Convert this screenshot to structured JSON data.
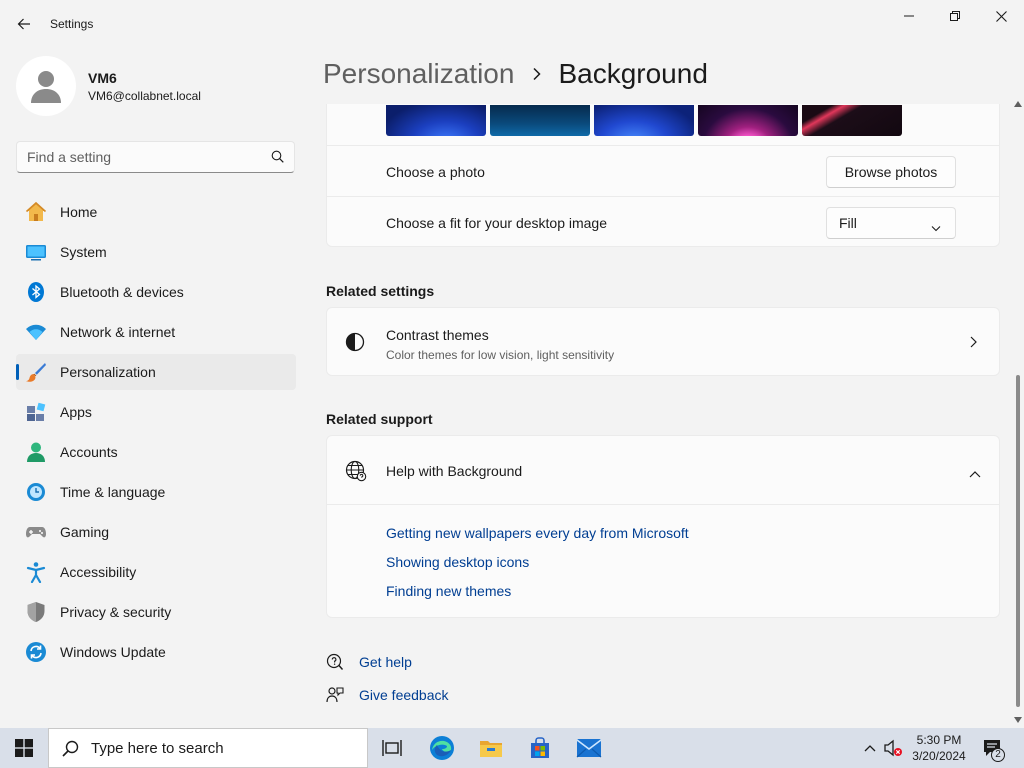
{
  "window": {
    "title": "Settings",
    "controls": [
      "minimize",
      "maximize",
      "close"
    ]
  },
  "user": {
    "name": "VM6",
    "email": "VM6@collabnet.local"
  },
  "search": {
    "placeholder": "Find a setting"
  },
  "sidebar": {
    "items": [
      {
        "label": "Home",
        "icon": "home-icon"
      },
      {
        "label": "System",
        "icon": "system-icon"
      },
      {
        "label": "Bluetooth & devices",
        "icon": "bluetooth-icon"
      },
      {
        "label": "Network & internet",
        "icon": "wifi-icon"
      },
      {
        "label": "Personalization",
        "icon": "brush-icon",
        "active": true
      },
      {
        "label": "Apps",
        "icon": "apps-icon"
      },
      {
        "label": "Accounts",
        "icon": "accounts-icon"
      },
      {
        "label": "Time & language",
        "icon": "clock-globe-icon"
      },
      {
        "label": "Gaming",
        "icon": "gamepad-icon"
      },
      {
        "label": "Accessibility",
        "icon": "accessibility-icon"
      },
      {
        "label": "Privacy & security",
        "icon": "shield-icon"
      },
      {
        "label": "Windows Update",
        "icon": "update-icon"
      }
    ]
  },
  "breadcrumb": {
    "parent": "Personalization",
    "current": "Background"
  },
  "background_card": {
    "thumbnail_count": 5,
    "choose_photo_label": "Choose a photo",
    "browse_button": "Browse photos",
    "fit_label": "Choose a fit for your desktop image",
    "fit_value": "Fill"
  },
  "related_settings": {
    "title": "Related settings",
    "contrast_title": "Contrast themes",
    "contrast_subtitle": "Color themes for low vision, light sensitivity"
  },
  "related_support": {
    "title": "Related support",
    "help_title": "Help with Background",
    "links": [
      "Getting new wallpapers every day from Microsoft",
      "Showing desktop icons",
      "Finding new themes"
    ]
  },
  "footer_links": {
    "get_help": "Get help",
    "give_feedback": "Give feedback"
  },
  "taskbar": {
    "search_placeholder": "Type here to search",
    "time": "5:30 PM",
    "date": "3/20/2024",
    "notification_count": "2"
  },
  "colors": {
    "accent": "#005fb8",
    "link": "#003e92",
    "taskbar": "#d9dfe9"
  }
}
